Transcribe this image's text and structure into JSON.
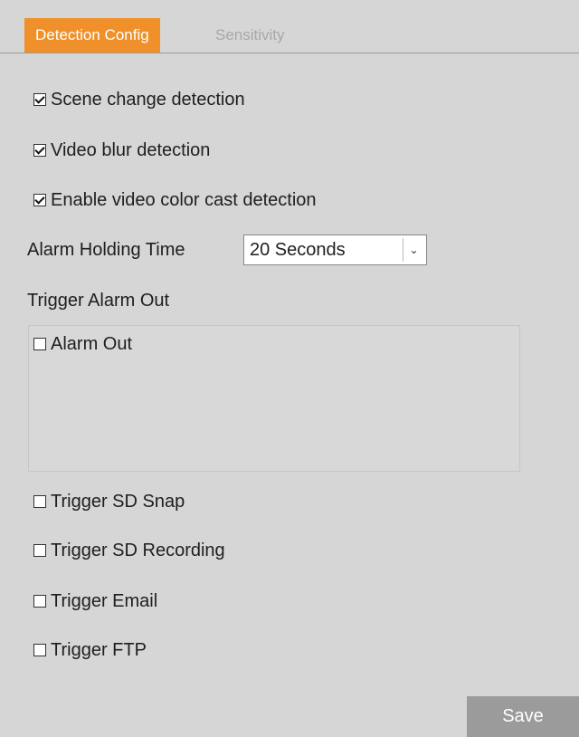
{
  "tabs": [
    {
      "label": "Detection Config",
      "active": true
    },
    {
      "label": "Sensitivity",
      "active": false
    }
  ],
  "options": {
    "scene_change": {
      "label": "Scene change detection",
      "checked": true
    },
    "video_blur": {
      "label": "Video blur detection",
      "checked": true
    },
    "color_cast": {
      "label": "Enable video color cast detection",
      "checked": true
    }
  },
  "alarm_holding": {
    "label": "Alarm Holding Time",
    "value": "20 Seconds"
  },
  "trigger_alarm_out": {
    "label": "Trigger Alarm Out",
    "items": [
      {
        "label": "Alarm Out",
        "checked": false
      }
    ]
  },
  "triggers": [
    {
      "label": "Trigger SD Snap",
      "checked": false
    },
    {
      "label": "Trigger SD Recording",
      "checked": false
    },
    {
      "label": "Trigger Email",
      "checked": false
    },
    {
      "label": "Trigger FTP",
      "checked": false
    }
  ],
  "save_label": "Save",
  "colors": {
    "accent": "#f0902a",
    "background": "#d6d6d6",
    "button": "#9b9b9b"
  }
}
